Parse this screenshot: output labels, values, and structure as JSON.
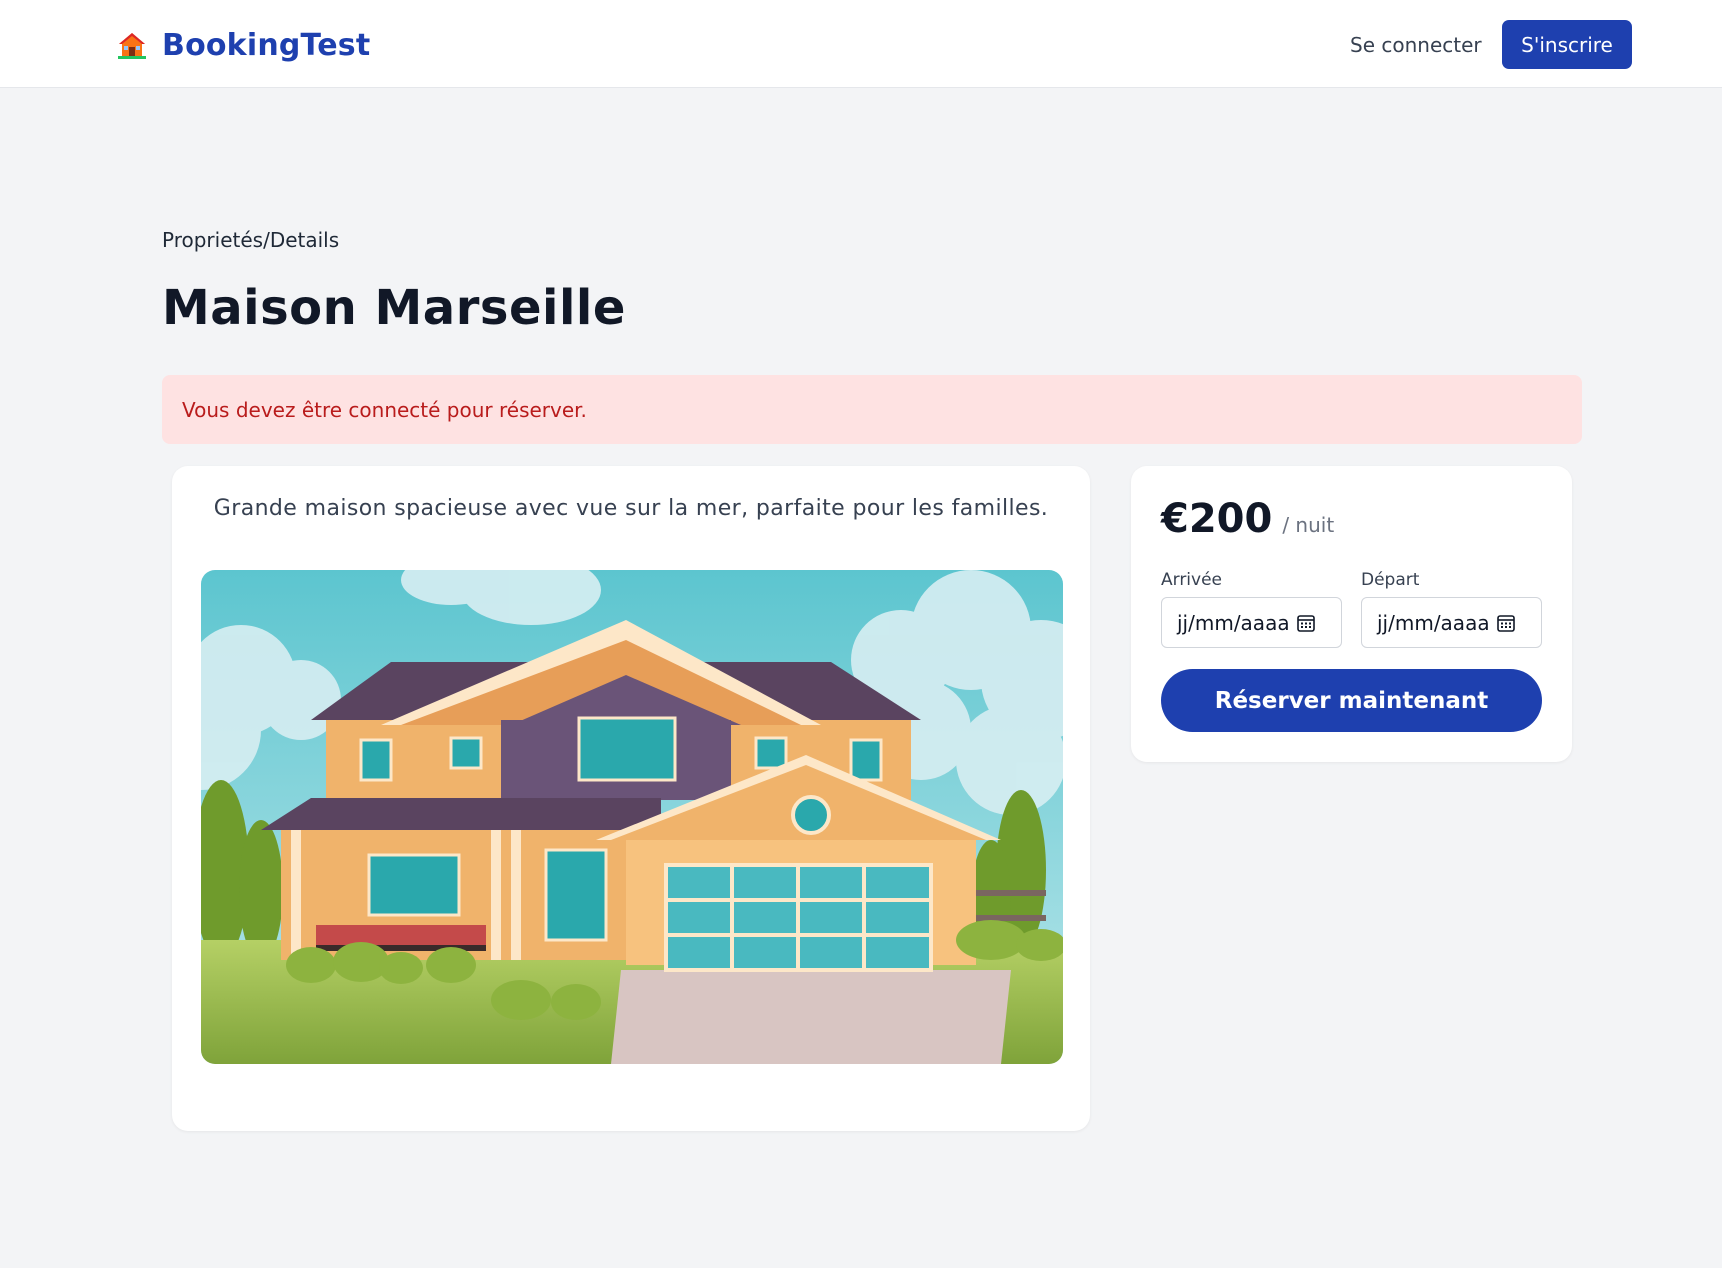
{
  "header": {
    "brand_name": "BookingTest",
    "brand_icon": "house-icon",
    "login_label": "Se connecter",
    "signup_label": "S'inscrire"
  },
  "page": {
    "breadcrumb": "Proprietés/Details",
    "title": "Maison Marseille",
    "alert": "Vous devez être connecté pour réserver."
  },
  "property": {
    "description": "Grande maison spacieuse avec vue sur la mer, parfaite pour les familles."
  },
  "booking": {
    "price": "€200",
    "per_night": "/ nuit",
    "arrival_label": "Arrivée",
    "departure_label": "Départ",
    "arrival_placeholder": "jj/mm/aaaa",
    "departure_placeholder": "jj/mm/aaaa",
    "calendar_icon": "calendar-icon",
    "reserve_label": "Réserver maintenant"
  },
  "colors": {
    "brand": "#1e40af",
    "page_bg": "#f3f4f6",
    "alert_bg": "#fee2e2",
    "alert_text": "#b91c1c"
  }
}
